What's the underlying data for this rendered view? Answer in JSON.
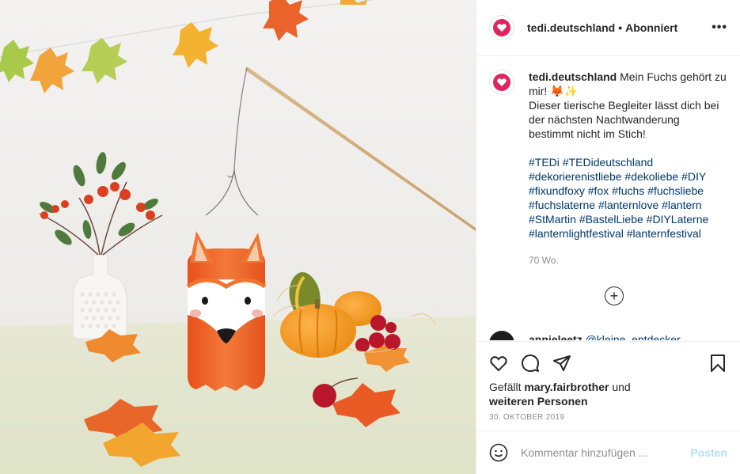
{
  "post": {
    "image_alt": "Fox lantern made from a plastic bottle with autumn leaves and pumpkins",
    "colors": {
      "brand": "#e0245e",
      "link": "#00376b",
      "muted": "#8e8e8e",
      "post_disabled": "#b2dffc"
    }
  },
  "header": {
    "username": "tedi.deutschland",
    "separator": "•",
    "follow_label": "Abonniert",
    "more_label": "•••"
  },
  "caption": {
    "username": "tedi.deutschland",
    "line1": "Mein Fuchs gehört zu mir! 🦊✨",
    "line2": "Dieser tierische Begleiter lässt dich bei der nächsten Nachtwanderung bestimmt nicht im Stich!",
    "hashtags": [
      "#TEDi",
      "#TEDideutschland",
      "#dekorierenistliebe",
      "#dekoliebe",
      "#DIY",
      "#fixundfoxy",
      "#fox",
      "#fuchs",
      "#fuchsliebe",
      "#fuchslaterne",
      "#lanternlove",
      "#lantern",
      "#StMartin",
      "#BastelLiebe",
      "#DIYLaterne",
      "#lanternlightfestival",
      "#lanternfestival"
    ],
    "age": "70 Wo."
  },
  "load_more_icon": "plus-circle-icon",
  "next_comment": {
    "username": "annieleetz",
    "text": "@kleine_entdecker"
  },
  "actions": {
    "icons": [
      "heart-icon",
      "comment-icon",
      "share-icon",
      "bookmark-icon"
    ],
    "likes_prefix": "Gefällt",
    "likes_user": "mary.fairbrother",
    "likes_and": "und",
    "likes_others": "weiteren Personen",
    "date": "30. OKTOBER 2019"
  },
  "comment_box": {
    "placeholder": "Kommentar hinzufügen ...",
    "post_label": "Posten"
  }
}
